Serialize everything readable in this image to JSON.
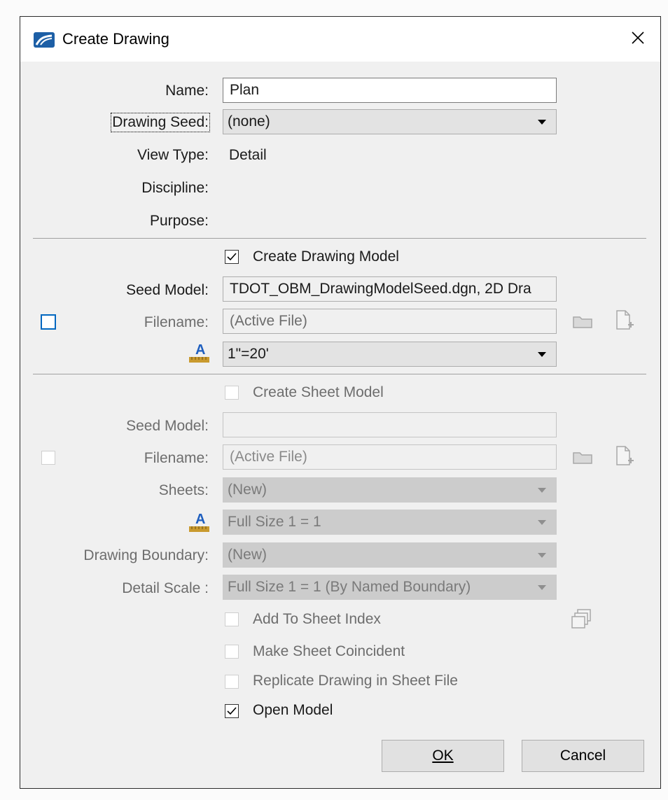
{
  "dialog": {
    "title": "Create Drawing",
    "close_glyph": "✕",
    "icons": {
      "app": "app-logo-icon",
      "close": "close-icon"
    }
  },
  "drawing": {
    "name_label": "Name:",
    "name_value": "Plan",
    "seed_label": "Drawing Seed:",
    "seed_value": "(none)",
    "view_type_label": "View Type:",
    "view_type_value": "Detail",
    "discipline_label": "Discipline:",
    "purpose_label": "Purpose:"
  },
  "drawing_model": {
    "create_label": "Create Drawing Model",
    "create_checked": true,
    "seed_model_label": "Seed Model:",
    "seed_model_value": "TDOT_OBM_DrawingModelSeed.dgn, 2D Dra",
    "filename_checked": false,
    "filename_label": "Filename:",
    "filename_value": "(Active File)",
    "scale_value": "1\"=20'",
    "icons": {
      "browse": "folder-icon",
      "new_file": "new-file-icon",
      "annotation_scale": "annotation-scale-icon"
    }
  },
  "sheet_model": {
    "create_label": "Create Sheet Model",
    "create_checked": false,
    "seed_model_label": "Seed Model:",
    "seed_model_value": "",
    "filename_checked": false,
    "filename_label": "Filename:",
    "filename_value": "(Active File)",
    "sheets_label": "Sheets:",
    "sheets_value": "(New)",
    "scale_value": "Full Size 1 = 1",
    "boundary_label": "Drawing Boundary:",
    "boundary_value": "(New)",
    "detail_scale_label": "Detail Scale :",
    "detail_scale_value": "Full Size 1 = 1 (By Named Boundary)",
    "add_index_label": "Add To Sheet Index",
    "add_index_checked": false,
    "coincident_label": "Make Sheet Coincident",
    "coincident_checked": false,
    "replicate_label": "Replicate Drawing in Sheet File",
    "replicate_checked": false,
    "icons": {
      "sheet_index": "sheet-index-icon"
    }
  },
  "open_model": {
    "label": "Open Model",
    "checked": true
  },
  "buttons": {
    "ok_label": "OK",
    "cancel_label": "Cancel"
  },
  "colors": {
    "focus_blue": "#0067c0",
    "dialog_bg": "#f0f0f0",
    "scale_icon_blue": "#1f5fbf",
    "scale_icon_gold": "#c99a2e"
  }
}
